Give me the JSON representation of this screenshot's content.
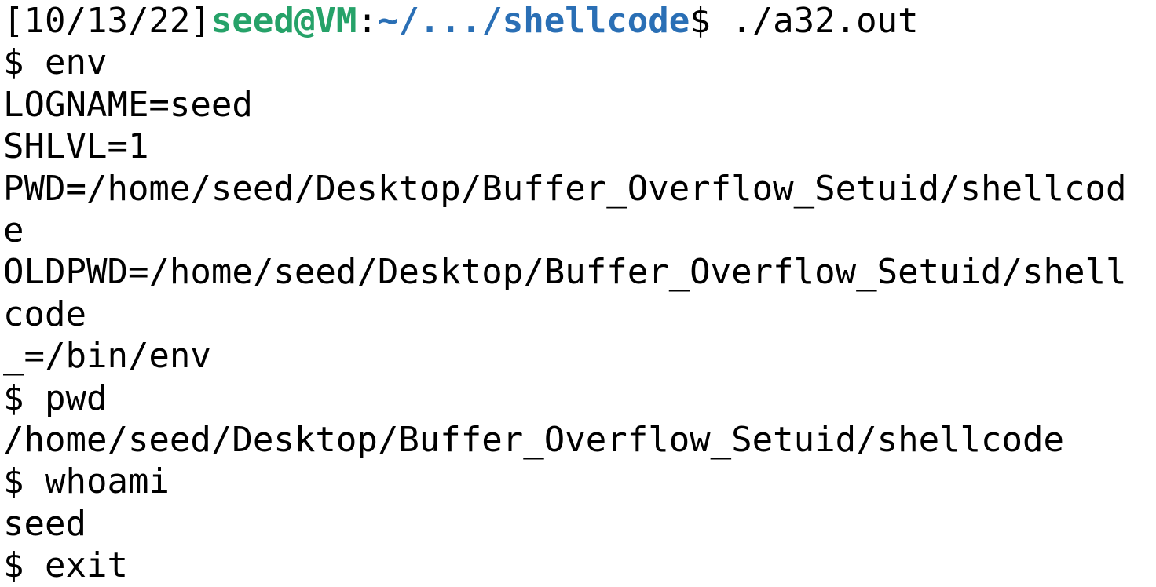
{
  "prompt": {
    "date": "[10/13/22]",
    "userhost": "seed@VM",
    "colon": ":",
    "path": "~/.../shellcode",
    "symbol": "$ ",
    "command": "./a32.out"
  },
  "colors": {
    "userhost": "#26a269",
    "path": "#2a6fb5",
    "text": "#000000",
    "background": "#ffffff"
  },
  "lines": [
    "$ env",
    "LOGNAME=seed",
    "SHLVL=1",
    "PWD=/home/seed/Desktop/Buffer_Overflow_Setuid/shellcod",
    "e",
    "OLDPWD=/home/seed/Desktop/Buffer_Overflow_Setuid/shell",
    "code",
    "_=/bin/env",
    "$ pwd",
    "/home/seed/Desktop/Buffer_Overflow_Setuid/shellcode",
    "$ whoami",
    "seed",
    "$ exit"
  ]
}
